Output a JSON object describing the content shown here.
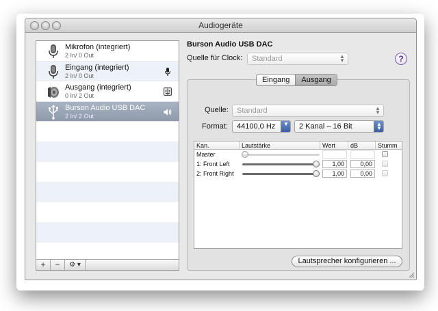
{
  "window": {
    "title": "Audiogeräte"
  },
  "devices": [
    {
      "name": "Mikrofon (integriert)",
      "io": "2 In/ 0 Out",
      "icon": "microphone-icon",
      "tag": ""
    },
    {
      "name": "Eingang (integriert)",
      "io": "2 In/ 0 Out",
      "icon": "microphone-icon",
      "tag": "microphone-icon"
    },
    {
      "name": "Ausgang (integriert)",
      "io": "0 In/ 2 Out",
      "icon": "speaker-icon",
      "tag": "finder-icon"
    },
    {
      "name": "Burson Audio USB DAC",
      "io": "2 In/ 2 Out",
      "icon": "usb-icon",
      "tag": "speaker-volume-icon"
    }
  ],
  "sidebar_toolbar": {
    "add": "+",
    "remove": "−",
    "action": "⚙ ▾"
  },
  "detail": {
    "device_title": "Burson Audio USB DAC",
    "clock_label": "Quelle für Clock:",
    "clock_value": "Standard",
    "help": "?",
    "tabs": [
      "Eingang",
      "Ausgang"
    ],
    "active_tab": "Ausgang",
    "source_label": "Quelle:",
    "source_value": "Standard",
    "format_label": "Format:",
    "format_rate": "44100,0 Hz",
    "format_channels": "2 Kanal – 16 Bit",
    "configure_button": "Lautsprecher konfigurieren ..."
  },
  "volume_table": {
    "headers": [
      "Kan.",
      "Lautstärke",
      "Wert",
      "dB",
      "Stumm"
    ],
    "rows": [
      {
        "channel": "Master",
        "value": "",
        "db": "",
        "level": 0.0,
        "enabled": false
      },
      {
        "channel": "1: Front Left",
        "value": "1,00",
        "db": "0,00",
        "level": 1.0,
        "enabled": true
      },
      {
        "channel": "2: Front Right",
        "value": "1,00",
        "db": "0,00",
        "level": 1.0,
        "enabled": true
      }
    ]
  },
  "colors": {
    "selection": "#98a4b5",
    "accent": "#4a6fb5",
    "help": "#6a4aa5"
  }
}
